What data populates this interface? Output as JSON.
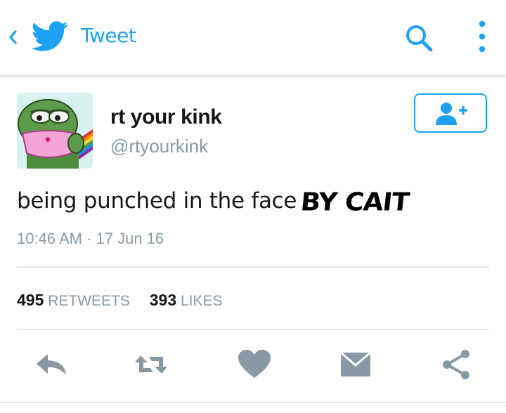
{
  "header": {
    "title": "Tweet",
    "icons": [
      "back-chevron-icon",
      "twitter-bird-icon",
      "search-icon",
      "more-options-icon"
    ],
    "accent_color": "#1da1f2"
  },
  "tweet": {
    "display_name": "rt your kink",
    "handle": "@rtyourkink",
    "text": "being punched in the face",
    "annotation": "BY CAIT",
    "timestamp": "10:46 AM · 17 Jun 16",
    "stats": {
      "retweets_count": "495",
      "retweets_label": "RETWEETS",
      "likes_count": "393",
      "likes_label": "LIKES"
    },
    "follow_icon": "follow-user-icon",
    "actions": [
      "reply-icon",
      "retweet-icon",
      "like-heart-icon",
      "direct-message-icon",
      "share-icon"
    ]
  }
}
